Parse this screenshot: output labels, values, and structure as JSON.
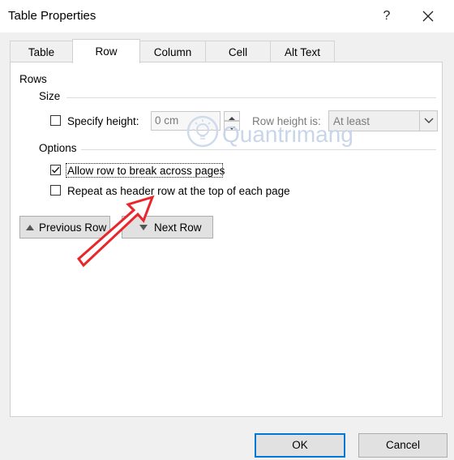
{
  "window": {
    "title": "Table Properties",
    "help_label": "?"
  },
  "tabs": [
    {
      "label": "Table",
      "active": false
    },
    {
      "label": "Row",
      "active": true
    },
    {
      "label": "Column",
      "active": false
    },
    {
      "label": "Cell",
      "active": false
    },
    {
      "label": "Alt Text",
      "active": false
    }
  ],
  "rows_section": {
    "heading": "Rows",
    "size_heading": "Size",
    "specify_height": {
      "label": "Specify height:",
      "checked": false
    },
    "height_value": "0 cm",
    "row_height_is_label": "Row height is:",
    "row_height_rule": "At least",
    "options_heading": "Options",
    "allow_break": {
      "label": "Allow row to break across pages",
      "checked": true
    },
    "repeat_header": {
      "label": "Repeat as header row at the top of each page",
      "checked": false
    }
  },
  "nav": {
    "previous_row": "Previous Row",
    "next_row": "Next Row"
  },
  "footer": {
    "ok": "OK",
    "cancel": "Cancel"
  },
  "watermark": {
    "text": "Quantrimang"
  },
  "colors": {
    "accent": "#0078d7",
    "annotation_arrow": "#e8262b",
    "dialog_bg": "#f0f0f0"
  }
}
